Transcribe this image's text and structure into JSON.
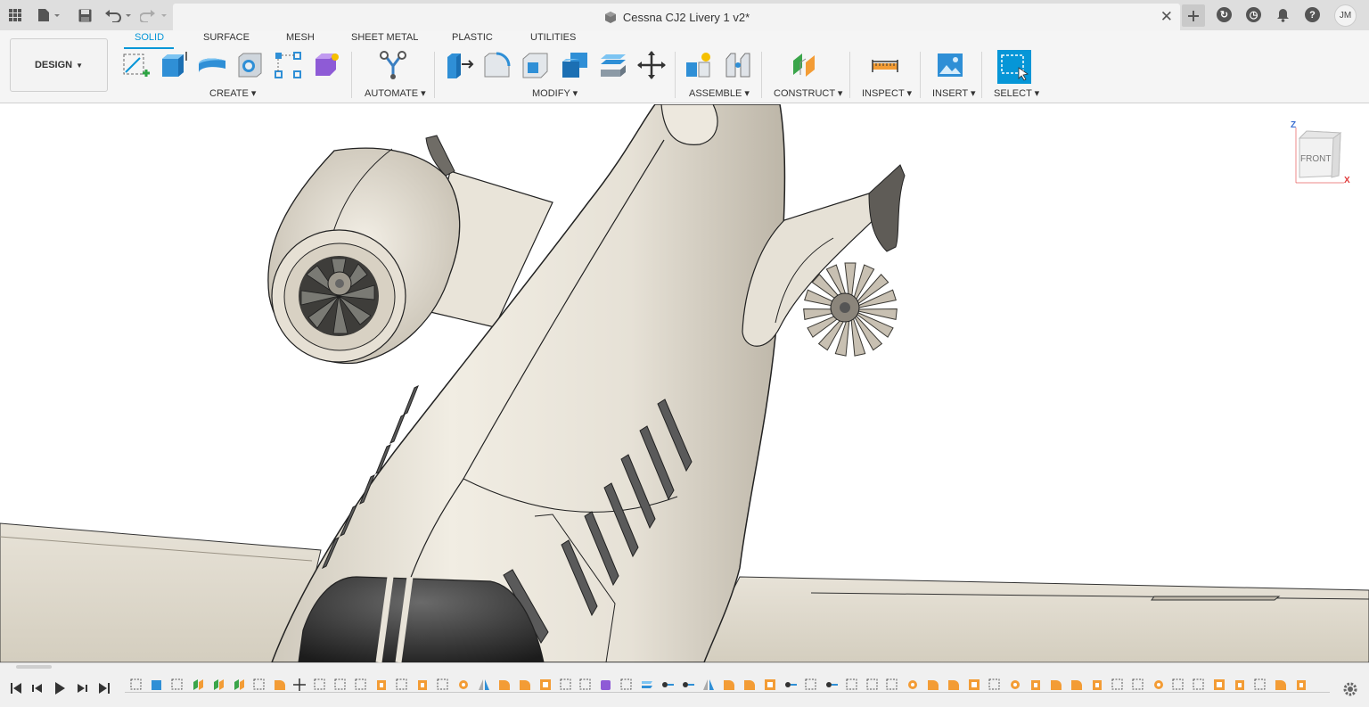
{
  "window": {
    "title": "Cessna CJ2 Livery 1 v2*",
    "user_initials": "JM"
  },
  "workspace": {
    "label": "DESIGN"
  },
  "tabs": [
    "SOLID",
    "SURFACE",
    "MESH",
    "SHEET METAL",
    "PLASTIC",
    "UTILITIES"
  ],
  "groups": {
    "create": "CREATE",
    "automate": "AUTOMATE",
    "modify": "MODIFY",
    "assemble": "ASSEMBLE",
    "construct": "CONSTRUCT",
    "inspect": "INSPECT",
    "insert": "INSERT",
    "select": "SELECT"
  },
  "viewcube": {
    "face": "FRONT",
    "axis_z": "Z",
    "axis_x": "X"
  },
  "colors": {
    "accent": "#0696d7",
    "orange": "#f39c35"
  }
}
